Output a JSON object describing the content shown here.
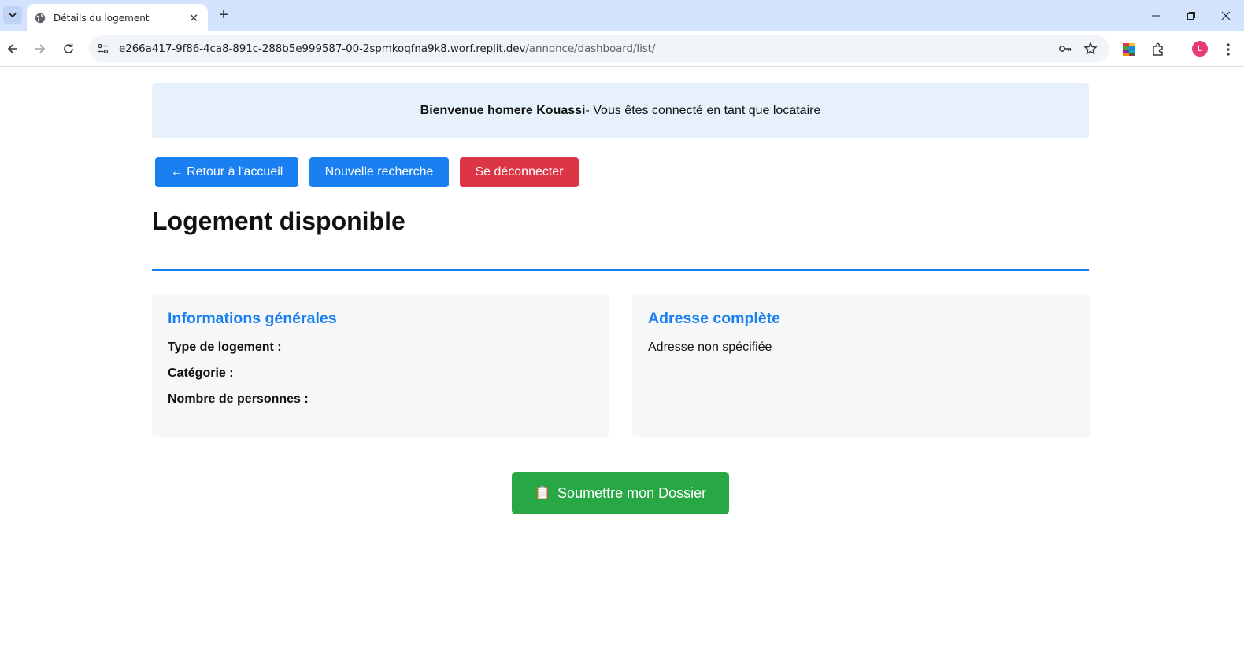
{
  "browser": {
    "tab_title": "Détails du logement",
    "tab_close": "✕",
    "new_tab": "+",
    "url_host": "e266a417-9f86-4ca8-891c-288b5e999587-00-2spmkoqfna9k8.worf.replit.dev",
    "url_path": "/annonce/dashboard/list/",
    "avatar_letter": "L"
  },
  "welcome": {
    "name": "Bienvenue homere Kouassi",
    "message": " - Vous êtes connecté en tant que locataire"
  },
  "buttons": {
    "home": "← Retour à l'accueil",
    "new_search": "Nouvelle recherche",
    "logout": "Se déconnecter"
  },
  "page_title": "Logement disponible",
  "general_info": {
    "heading": "Informations générales",
    "type_label": "Type de logement :",
    "category_label": "Catégorie :",
    "persons_label": "Nombre de personnes :"
  },
  "address": {
    "heading": "Adresse complète",
    "value": "Adresse non spécifiée"
  },
  "submit": {
    "icon": "📋",
    "label": "Soumettre mon Dossier"
  },
  "colors": {
    "primary": "#1a7ff0",
    "danger": "#dc3545",
    "success": "#28a745",
    "welcome_bg": "#e6f1fc",
    "card_bg": "#f6f7f9"
  }
}
